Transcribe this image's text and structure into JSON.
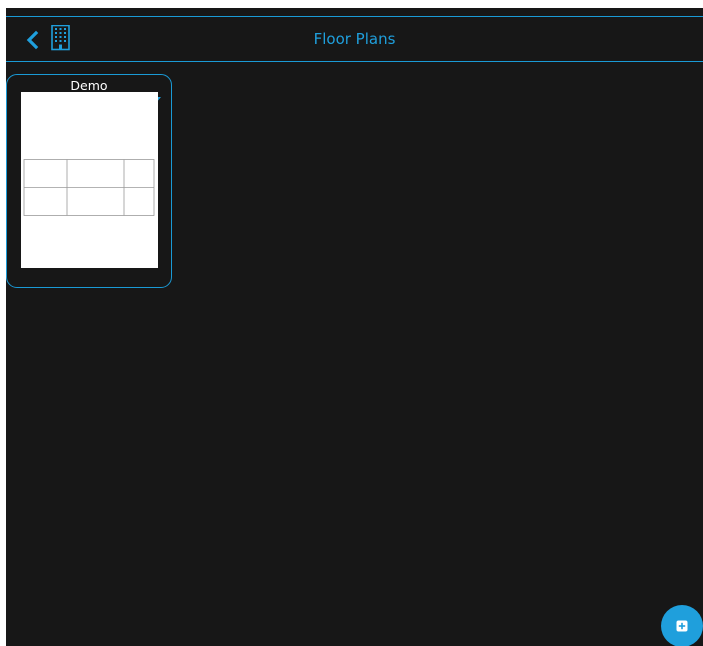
{
  "header": {
    "title": "Floor Plans",
    "back_icon": "chevron-left-icon",
    "building_icon": "building-icon"
  },
  "floor_plans": [
    {
      "name": "Demo",
      "menu_icon": "triangle-down-icon"
    }
  ],
  "fab": {
    "icon": "add-square-icon"
  },
  "colors": {
    "background": "#171717",
    "accent": "#1f9fdc",
    "text": "#ffffff"
  }
}
